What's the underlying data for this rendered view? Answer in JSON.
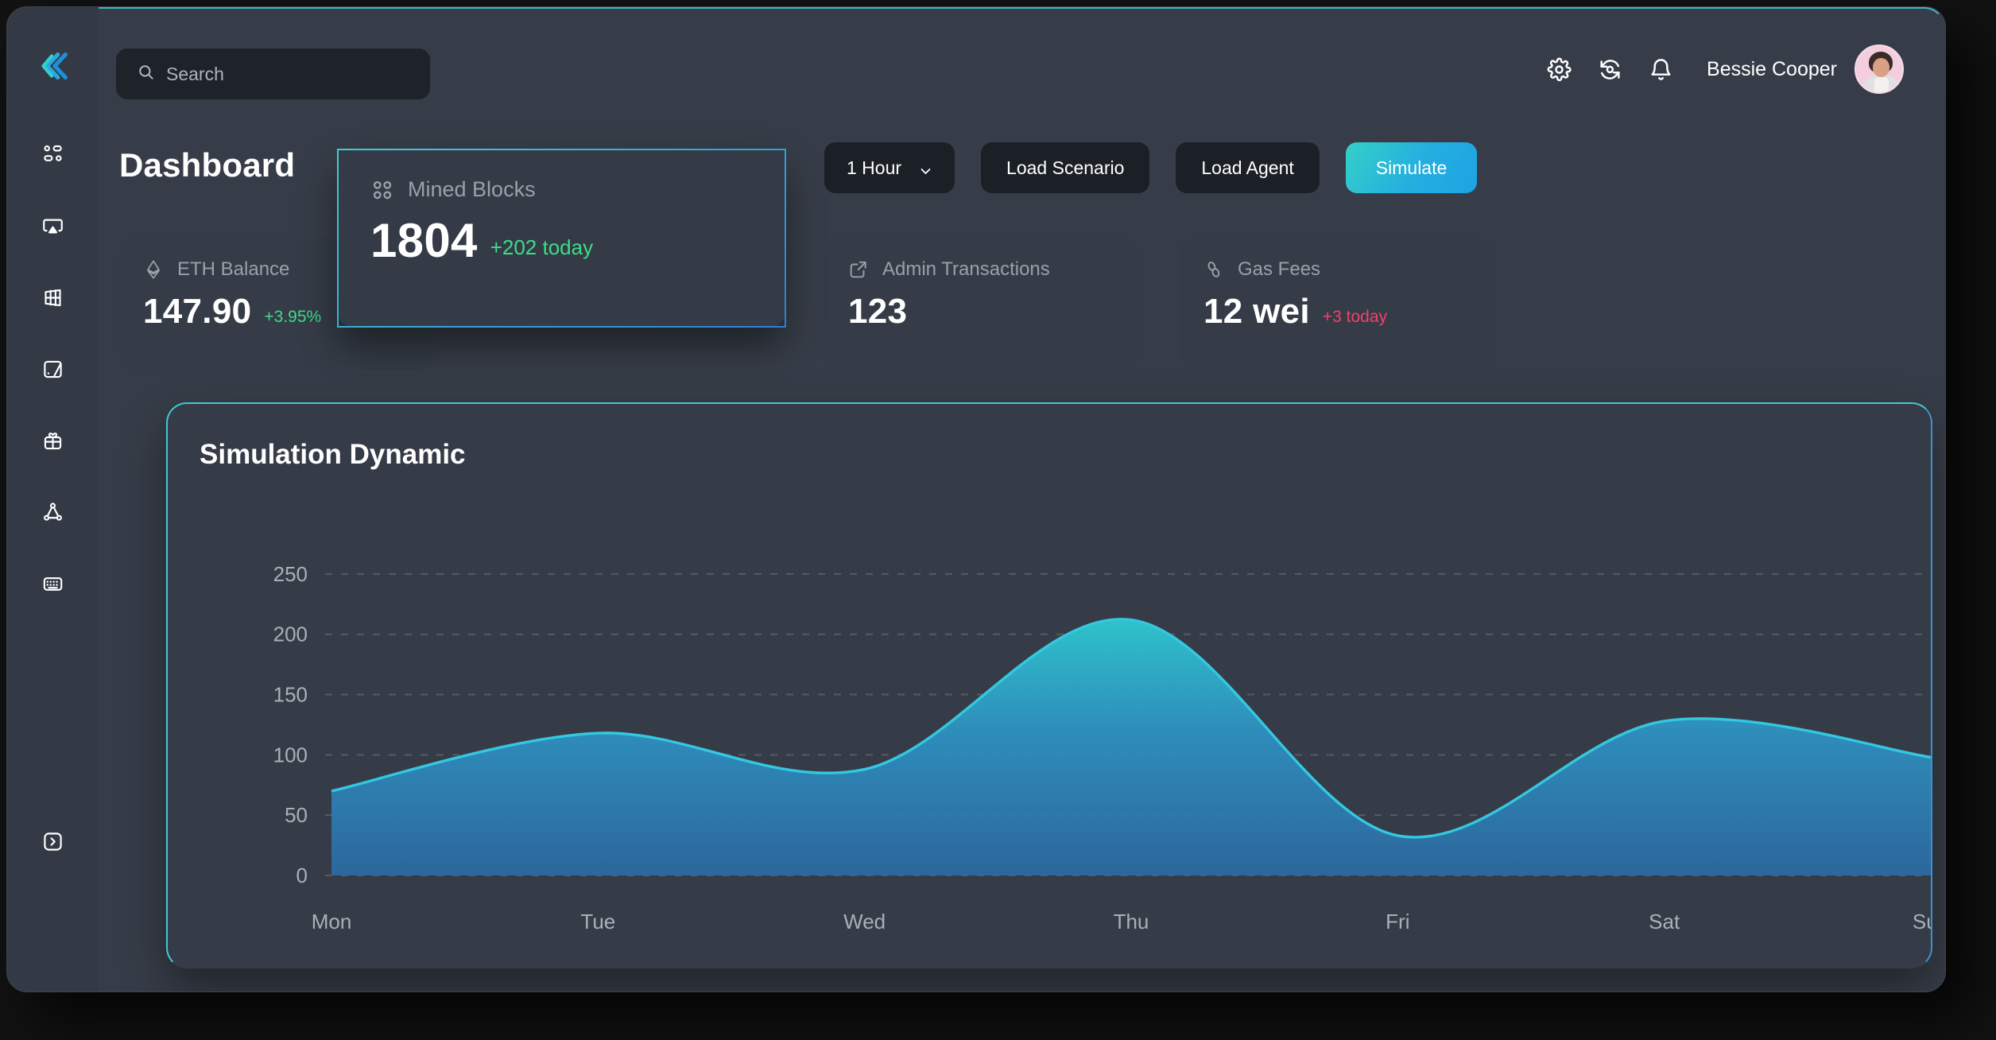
{
  "brand": {
    "logo_icon": "chevrons-left-logo",
    "accent": "#3fc8d7"
  },
  "search": {
    "placeholder": "Search",
    "icon": "search-icon"
  },
  "topbar": {
    "icons": [
      {
        "name": "gear-icon",
        "label": "Settings"
      },
      {
        "name": "history-refresh-icon",
        "label": "Refresh"
      },
      {
        "name": "bell-icon",
        "label": "Notifications"
      }
    ],
    "user_name": "Bessie Cooper",
    "avatar": "user-avatar"
  },
  "sidebar": {
    "items": [
      {
        "icon": "dashboard-grid-icon",
        "name": "sidebar-item-dashboard"
      },
      {
        "icon": "airplay-monitor-icon",
        "name": "sidebar-item-monitor"
      },
      {
        "icon": "grid-table-icon",
        "name": "sidebar-item-table"
      },
      {
        "icon": "file-chart-icon",
        "name": "sidebar-item-reports"
      },
      {
        "icon": "gift-box-icon",
        "name": "sidebar-item-rewards"
      },
      {
        "icon": "network-nodes-icon",
        "name": "sidebar-item-network"
      },
      {
        "icon": "keyboard-icon",
        "name": "sidebar-item-keyboard"
      }
    ],
    "bottom": {
      "icon": "chevron-right-box-icon",
      "name": "sidebar-collapse-toggle"
    }
  },
  "page": {
    "title": "Dashboard"
  },
  "toolbar": {
    "range_label": "1 Hour",
    "range_icon": "chevron-down-icon",
    "load_scenario_label": "Load Scenario",
    "load_agent_label": "Load Agent",
    "simulate_label": "Simulate"
  },
  "cards": [
    {
      "id": "eth",
      "icon": "ethereum-icon",
      "label": "ETH Balance",
      "value": "147.90",
      "delta": "+3.95%",
      "delta_dir": "up"
    },
    {
      "id": "mined",
      "icon": "blocks-grid-icon",
      "label": "Mined Blocks",
      "value": "1804",
      "delta": "+202 today",
      "delta_dir": "up"
    },
    {
      "id": "admin",
      "icon": "external-link-icon",
      "label": "Admin Transactions",
      "value": "123",
      "delta": "",
      "delta_dir": "none"
    },
    {
      "id": "gas",
      "icon": "gas-drop-icon",
      "label": "Gas Fees",
      "value": "12 wei",
      "delta": "+3 today",
      "delta_dir": "down"
    }
  ],
  "chart_data": {
    "type": "area",
    "title": "Simulation Dynamic",
    "xlabel": "",
    "ylabel": "",
    "categories": [
      "Mon",
      "Tue",
      "Wed",
      "Thu",
      "Fri",
      "Sat",
      "Sun"
    ],
    "x": [
      "Mon",
      "Tue",
      "Wed",
      "Thu",
      "Fri",
      "Sat",
      "Sun"
    ],
    "series": [
      {
        "name": "Simulation Dynamic",
        "values": [
          70,
          118,
          88,
          212,
          33,
          128,
          98
        ]
      }
    ],
    "values": [
      70,
      118,
      88,
      212,
      33,
      128,
      98
    ],
    "yticks": [
      0,
      50,
      100,
      150,
      200,
      250
    ],
    "ylim": [
      0,
      275
    ],
    "grid": true,
    "grid_style": "dashed",
    "legend": "none",
    "line_color": "#34c8e0",
    "fill_gradient": [
      "#2fc5cd",
      "#2b6da8"
    ]
  }
}
